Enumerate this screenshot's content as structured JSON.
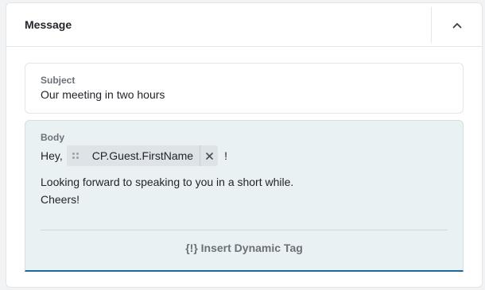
{
  "panel": {
    "title": "Message"
  },
  "icons": {
    "collapse": "chevron-up-icon",
    "drag": "drag-handle-icon",
    "remove": "close-icon"
  },
  "subject": {
    "label": "Subject",
    "value": "Our meeting in two hours"
  },
  "body": {
    "label": "Body",
    "greeting": "Hey,",
    "tag": "CP.Guest.FirstName",
    "after_tag": "!",
    "line2": "Looking forward to speaking to you in a short while.",
    "line3": "Cheers!",
    "insert_tag_label": "{!} Insert Dynamic Tag"
  },
  "colors": {
    "accent": "#1b6a96",
    "body_bg": "#eaf1f3",
    "chip_bg": "#dde3e6"
  }
}
